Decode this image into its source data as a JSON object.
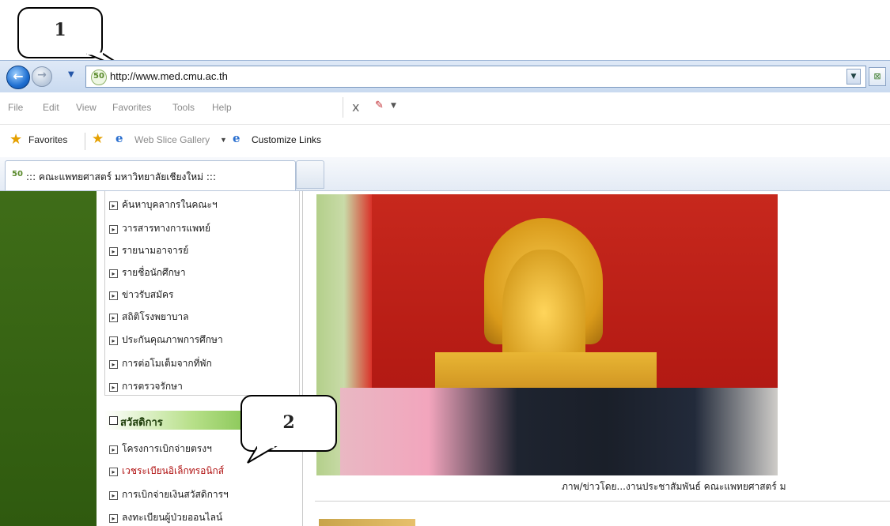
{
  "callouts": {
    "one": "1",
    "two": "2"
  },
  "address_bar": {
    "url": "http://www.med.cmu.ac.th",
    "site_icon": "50"
  },
  "menu": {
    "items": [
      "File",
      "Edit",
      "View",
      "Favorites",
      "Tools",
      "Help"
    ],
    "x_label": "x"
  },
  "favorites_bar": {
    "favorites_label": "Favorites",
    "web_slice_label": "Web Slice Gallery",
    "customize_label": "Customize Links"
  },
  "tab": {
    "title": "::: คณะแพทยศาสตร์ มหาวิทยาลัยเชียงใหม่ :::",
    "favicon": "50"
  },
  "sidebar": {
    "links": [
      "ค้นหาบุคลากรในคณะฯ",
      "วารสารทางการแพทย์",
      "รายนามอาจารย์",
      "รายชื่อนักศึกษา",
      "ข่าวรับสมัคร",
      "สถิติโรงพยาบาล",
      "ประกันคุณภาพการศึกษา",
      "การต่อโมเต็มจากที่พัก",
      "การตรวจรักษา"
    ],
    "welfare_title": "สวัสดิการ",
    "welfare_links": [
      "โครงการเบิกจ่ายตรงฯ",
      "เวชระเบียนอิเล็กทรอนิกส์",
      "การเบิกจ่ายเงินสวัสดิการฯ",
      "ลงทะเบียนผู้ป่วยออนไลน์"
    ]
  },
  "content": {
    "caption": "ภาพ/ข่าวโดย...งานประชาสัมพันธ์ คณะแพทยศาสตร์ ม"
  },
  "colors": {
    "sidebar_green": "#3f6d18",
    "photo_red": "#c7281d",
    "welfare_green": "#5fb12a"
  }
}
